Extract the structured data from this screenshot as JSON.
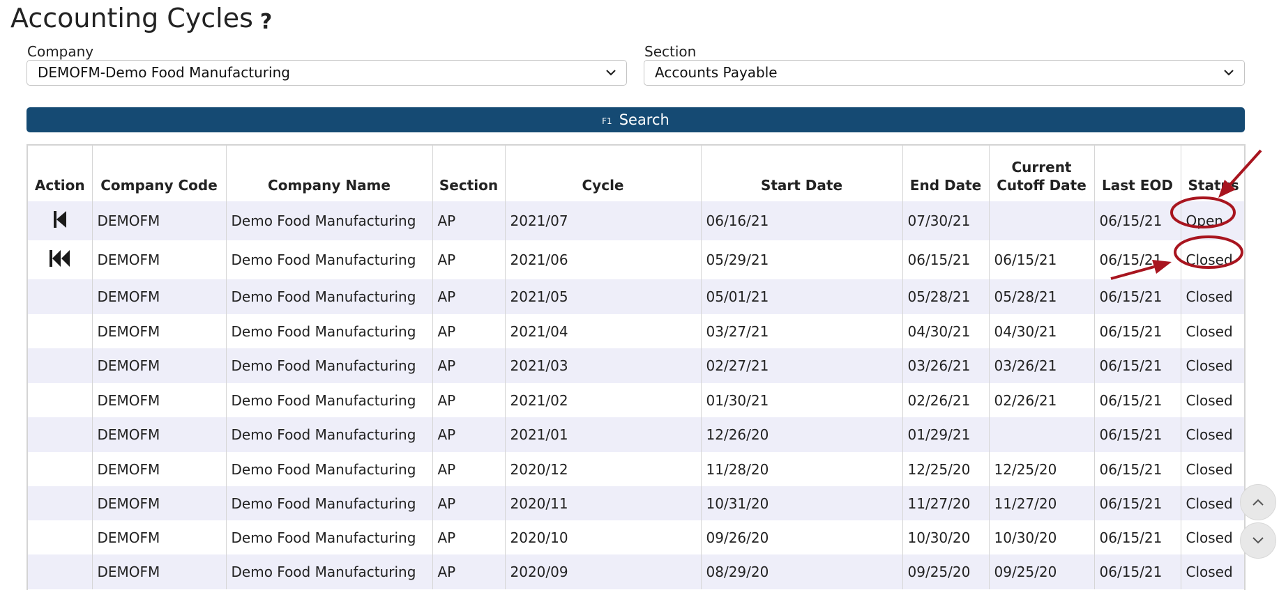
{
  "page": {
    "title": "Accounting Cycles",
    "help_icon": "?"
  },
  "filters": {
    "company_label": "Company",
    "company_value": "DEMOFM-Demo Food Manufacturing",
    "section_label": "Section",
    "section_value": "Accounts Payable"
  },
  "search": {
    "key_hint": "F1",
    "label": "Search"
  },
  "table": {
    "columns": [
      "Action",
      "Company Code",
      "Company Name",
      "Section",
      "Cycle",
      "Start Date",
      "End Date",
      "Current Cutoff Date",
      "Last EOD",
      "Status"
    ],
    "rows": [
      {
        "action": "step-back-icon",
        "code": "DEMOFM",
        "name": "Demo Food Manufacturing",
        "section": "AP",
        "cycle": "2021/07",
        "start": "06/16/21",
        "end": "07/30/21",
        "cutoff": "",
        "eod": "06/15/21",
        "status": "Open"
      },
      {
        "action": "fast-rewind-icon",
        "code": "DEMOFM",
        "name": "Demo Food Manufacturing",
        "section": "AP",
        "cycle": "2021/06",
        "start": "05/29/21",
        "end": "06/15/21",
        "cutoff": "06/15/21",
        "eod": "06/15/21",
        "status": "Closed"
      },
      {
        "action": "",
        "code": "DEMOFM",
        "name": "Demo Food Manufacturing",
        "section": "AP",
        "cycle": "2021/05",
        "start": "05/01/21",
        "end": "05/28/21",
        "cutoff": "05/28/21",
        "eod": "06/15/21",
        "status": "Closed"
      },
      {
        "action": "",
        "code": "DEMOFM",
        "name": "Demo Food Manufacturing",
        "section": "AP",
        "cycle": "2021/04",
        "start": "03/27/21",
        "end": "04/30/21",
        "cutoff": "04/30/21",
        "eod": "06/15/21",
        "status": "Closed"
      },
      {
        "action": "",
        "code": "DEMOFM",
        "name": "Demo Food Manufacturing",
        "section": "AP",
        "cycle": "2021/03",
        "start": "02/27/21",
        "end": "03/26/21",
        "cutoff": "03/26/21",
        "eod": "06/15/21",
        "status": "Closed"
      },
      {
        "action": "",
        "code": "DEMOFM",
        "name": "Demo Food Manufacturing",
        "section": "AP",
        "cycle": "2021/02",
        "start": "01/30/21",
        "end": "02/26/21",
        "cutoff": "02/26/21",
        "eod": "06/15/21",
        "status": "Closed"
      },
      {
        "action": "",
        "code": "DEMOFM",
        "name": "Demo Food Manufacturing",
        "section": "AP",
        "cycle": "2021/01",
        "start": "12/26/20",
        "end": "01/29/21",
        "cutoff": "",
        "eod": "06/15/21",
        "status": "Closed"
      },
      {
        "action": "",
        "code": "DEMOFM",
        "name": "Demo Food Manufacturing",
        "section": "AP",
        "cycle": "2020/12",
        "start": "11/28/20",
        "end": "12/25/20",
        "cutoff": "12/25/20",
        "eod": "06/15/21",
        "status": "Closed"
      },
      {
        "action": "",
        "code": "DEMOFM",
        "name": "Demo Food Manufacturing",
        "section": "AP",
        "cycle": "2020/11",
        "start": "10/31/20",
        "end": "11/27/20",
        "cutoff": "11/27/20",
        "eod": "06/15/21",
        "status": "Closed"
      },
      {
        "action": "",
        "code": "DEMOFM",
        "name": "Demo Food Manufacturing",
        "section": "AP",
        "cycle": "2020/10",
        "start": "09/26/20",
        "end": "10/30/20",
        "cutoff": "10/30/20",
        "eod": "06/15/21",
        "status": "Closed"
      },
      {
        "action": "",
        "code": "DEMOFM",
        "name": "Demo Food Manufacturing",
        "section": "AP",
        "cycle": "2020/09",
        "start": "08/29/20",
        "end": "09/25/20",
        "cutoff": "09/25/20",
        "eod": "06/15/21",
        "status": "Closed"
      }
    ]
  },
  "scroll": {
    "up_icon": "chevron-up-icon",
    "down_icon": "chevron-down-icon"
  },
  "colors": {
    "search_bg": "#154a73",
    "row_alt": "#eeeef9",
    "annotation": "#a8151f"
  }
}
